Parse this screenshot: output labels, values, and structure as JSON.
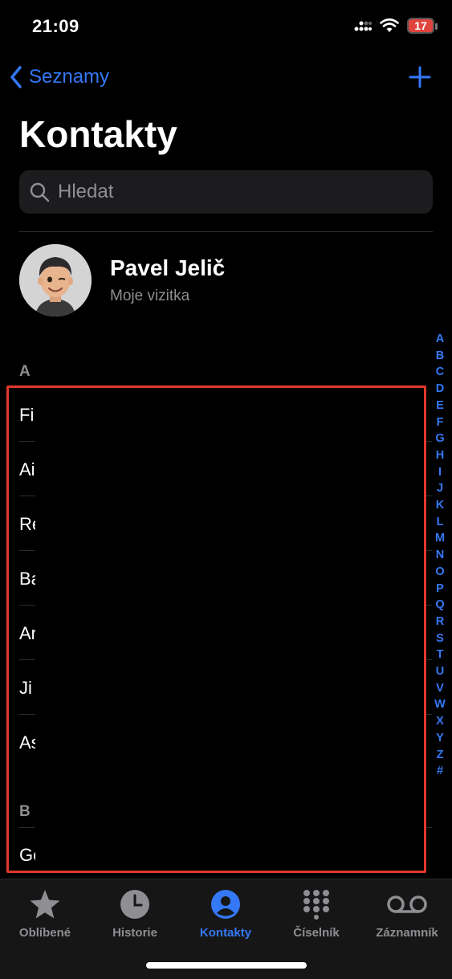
{
  "status": {
    "time": "21:09",
    "battery": "17"
  },
  "nav": {
    "back_label": "Seznamy"
  },
  "page": {
    "title": "Kontakty"
  },
  "search": {
    "placeholder": "Hledat"
  },
  "me_card": {
    "name": "Pavel Jelič",
    "subtitle": "Moje vizitka"
  },
  "sections": [
    {
      "letter": "A",
      "rows": [
        "Fi",
        "Ai",
        "Re",
        "Ba",
        "Ar",
        "Ji",
        "As"
      ]
    },
    {
      "letter": "B",
      "rows": [
        "Ge"
      ]
    }
  ],
  "index": [
    "A",
    "B",
    "C",
    "D",
    "E",
    "F",
    "G",
    "H",
    "I",
    "J",
    "K",
    "L",
    "M",
    "N",
    "O",
    "P",
    "Q",
    "R",
    "S",
    "T",
    "U",
    "V",
    "W",
    "X",
    "Y",
    "Z",
    "#"
  ],
  "tabs": [
    {
      "label": "Oblíbené",
      "icon": "star-icon"
    },
    {
      "label": "Historie",
      "icon": "clock-icon"
    },
    {
      "label": "Kontakty",
      "icon": "person-icon",
      "active": true
    },
    {
      "label": "Číselník",
      "icon": "keypad-icon"
    },
    {
      "label": "Záznamník",
      "icon": "voicemail-icon"
    }
  ],
  "colors": {
    "accent": "#3478f6",
    "highlight": "#e0392b",
    "background": "#000000"
  }
}
